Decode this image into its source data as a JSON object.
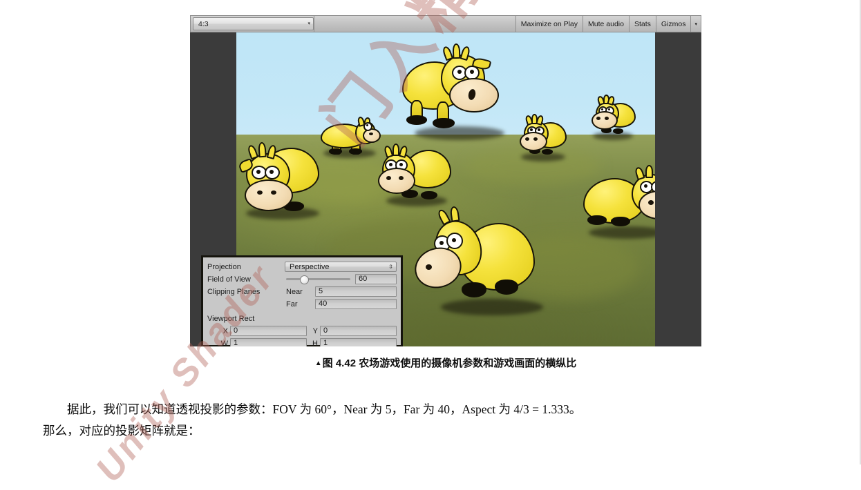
{
  "figure": {
    "toolbar": {
      "aspect_label": "4:3",
      "aspect_caret": "▾",
      "maximize_on_play": "Maximize on Play",
      "mute_audio": "Mute audio",
      "stats": "Stats",
      "gizmos": "Gizmos",
      "gizmos_caret": "▾"
    },
    "inspector": {
      "projection_label": "Projection",
      "projection_value": "Perspective",
      "projection_caret": "⇳",
      "field_of_view_label": "Field of View",
      "field_of_view_value": "60",
      "field_of_view_slider_percent": 28,
      "clipping_planes_label": "Clipping Planes",
      "near_label": "Near",
      "near_value": "5",
      "far_label": "Far",
      "far_value": "40",
      "viewport_rect_label": "Viewport Rect",
      "x_label": "X",
      "x_value": "0",
      "y_label": "Y",
      "y_value": "0",
      "w_label": "W",
      "w_value": "1",
      "h_label": "H",
      "h_value": "1"
    },
    "scene": {
      "sky_color": "#c3e7f7",
      "ground_color": "#7c8a48",
      "letterbox_color": "#3b3b3b",
      "cow_body_color": "#f5e23c",
      "cow_muzzle_color": "#f3dcb4",
      "description": "Yellow cartoon cows standing on a green grass field under a light blue sky"
    },
    "caption": {
      "marker": "▲",
      "text": "图 4.42    农场游戏使用的摄像机参数和游戏画面的横纵比"
    }
  },
  "body": {
    "paragraph_1": "据此，我们可以知道透视投影的参数：FOV 为 60°，Near 为 5，Far 为 40，Aspect 为 4/3 = 1.333。",
    "paragraph_2": "那么，对应的投影矩阵就是："
  },
  "watermark": {
    "main": "门入精",
    "sub": "Unity Shader"
  }
}
